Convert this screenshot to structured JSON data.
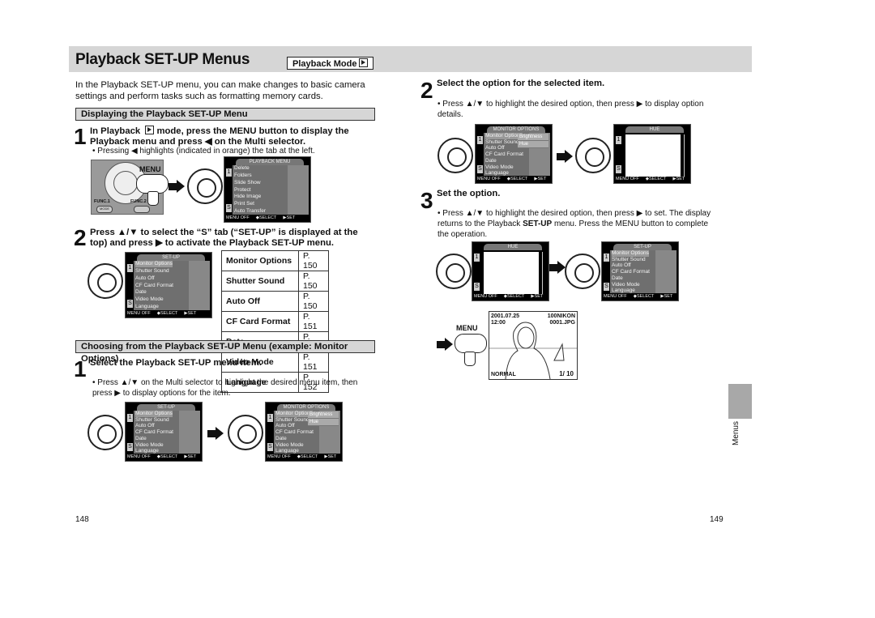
{
  "header": {
    "title": "Playback SET-UP Menus",
    "mode_badge": "Playback Mode",
    "mode_icon": "playback-icon"
  },
  "left": {
    "intro": "In the Playback SET-UP menu, you can make changes to basic camera settings and perform tasks such as formatting memory cards.",
    "section1": {
      "title": "Displaying the Playback SET-UP Menu",
      "step1": {
        "num": "1",
        "text_a": "In Playback",
        "text_b": "mode, press the MENU button to display the Playback menu and press ◀ on the Multi selector.",
        "bullet": "• Pressing ◀ highlights (indicated in orange) the tab at the left."
      },
      "step2": {
        "num": "2",
        "text": "Press ▲/▼ to select the “S” tab (“SET-UP” is displayed at the top) and press ▶ to activate the Playback SET-UP menu."
      },
      "camera": {
        "func1": "FUNC.1",
        "func2": "FUNC.2",
        "mode": "MODE"
      },
      "menu_label": "MENU",
      "page_table": [
        [
          "Monitor Options",
          "P. 150"
        ],
        [
          "Shutter Sound",
          "P. 150"
        ],
        [
          "Auto Off",
          "P. 150"
        ],
        [
          "CF Card Format",
          "P. 151"
        ],
        [
          "Date",
          "P. 151"
        ],
        [
          "Video Mode",
          "P. 151"
        ],
        [
          "Language",
          "P. 152"
        ]
      ]
    },
    "section2": {
      "title": "Choosing from the Playback SET-UP Menu (example: Monitor Options)",
      "step1": {
        "num": "1",
        "text": "Select the Playback SET-UP menu item.",
        "bullet": "• Press ▲/▼ on the Multi selector to highlight the desired menu item, then press ▶ to display options for the item."
      }
    }
  },
  "right": {
    "step2": {
      "num": "2",
      "text": "Select the option for the selected item.",
      "bullet": "• Press ▲/▼ to highlight the desired option, then press ▶ to display option details."
    },
    "step3": {
      "num": "3",
      "text": "Set the option.",
      "bullet_a": "• Press ▲/▼ to highlight the desired option, then press ▶ to set. The display returns to the Playback ",
      "bullet_bold": "SET-UP",
      "bullet_b": " menu. Press the MENU button to complete the operation."
    },
    "menu_label": "MENU",
    "photo": {
      "date": "2001.07.25",
      "time": "12:00",
      "folder": "100NIKON",
      "file": "0001.JPG",
      "quality": "NORMAL",
      "count": "1/ 10"
    }
  },
  "screens": {
    "playback": {
      "title": "PLAYBACK MENU",
      "items": [
        "Delete",
        "Folders",
        "Slide Show",
        "Protect",
        "Hide Image",
        "Print Set",
        "Auto Transfer"
      ]
    },
    "setup": {
      "title": "SET-UP",
      "items": [
        "Monitor Options",
        "Shutter Sound",
        "Auto Off",
        "CF Card Format",
        "Date",
        "Video Mode",
        "Language"
      ]
    },
    "monitor": {
      "title": "MONITOR OPTIONS",
      "items": [
        "Monitor Options",
        "Shutter Sound",
        "Auto Off",
        "CF Card Format",
        "Date",
        "Video Mode",
        "Language"
      ],
      "sub": [
        "Brightness",
        "Hue"
      ]
    },
    "hue": {
      "title": "HUE"
    },
    "footer": {
      "off": "MENU OFF",
      "select": "◆SELECT",
      "set": "▶SET"
    },
    "tab_1": "1",
    "tab_s": "S"
  },
  "side_tab": "Menus",
  "page_numbers": {
    "left": "148",
    "right": "149"
  },
  "colors": {
    "band": "#d6d6d6",
    "lcd_body": "#6f6f6f",
    "side_tab": "#a8a8a8"
  }
}
